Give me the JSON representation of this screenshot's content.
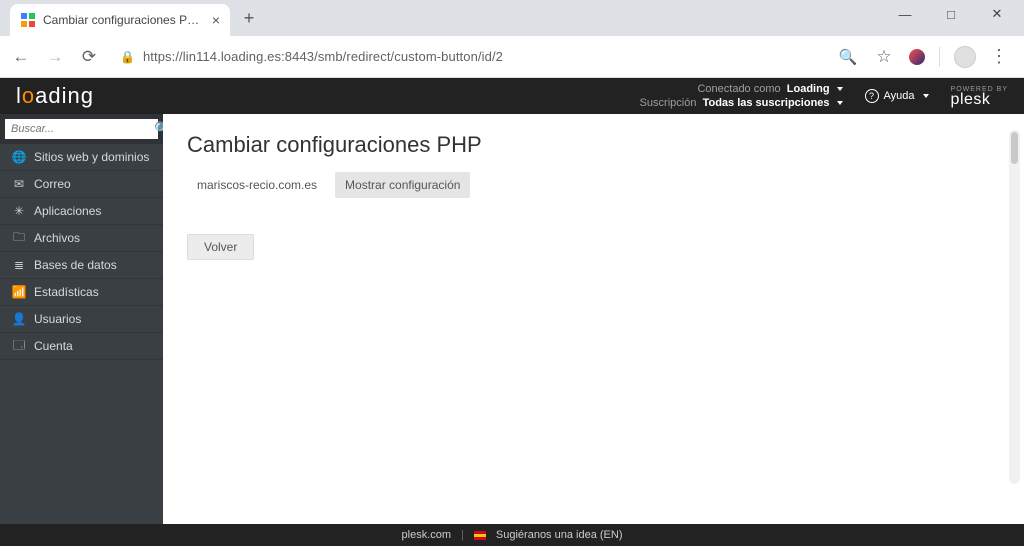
{
  "browser": {
    "tab_title": "Cambiar configuraciones PHP - L",
    "url": "https://lin114.loading.es:8443/smb/redirect/custom-button/id/2"
  },
  "brand": {
    "pre": "l",
    "accent": "o",
    "post": "ading"
  },
  "header": {
    "login_label": "Conectado como",
    "login_value": "Loading",
    "sub_label": "Suscripción",
    "sub_value": "Todas las suscripciones",
    "help": "Ayuda",
    "powered_by": "POWERED BY",
    "plesk": "plesk"
  },
  "sidebar": {
    "search_placeholder": "Buscar...",
    "items": [
      {
        "icon": "globe-icon",
        "label": "Sitios web y dominios"
      },
      {
        "icon": "mail-icon",
        "label": "Correo"
      },
      {
        "icon": "puzzle-icon",
        "label": "Aplicaciones"
      },
      {
        "icon": "folder-icon",
        "label": "Archivos"
      },
      {
        "icon": "database-icon",
        "label": "Bases de datos"
      },
      {
        "icon": "stats-icon",
        "label": "Estadísticas"
      },
      {
        "icon": "user-icon",
        "label": "Usuarios"
      },
      {
        "icon": "card-icon",
        "label": "Cuenta"
      }
    ]
  },
  "main": {
    "title": "Cambiar configuraciones PHP",
    "tabs": [
      {
        "label": "mariscos-recio.com.es",
        "active": false
      },
      {
        "label": "Mostrar configuración",
        "active": true
      }
    ],
    "back": "Volver"
  },
  "footer": {
    "link": "plesk.com",
    "suggest": "Sugiéranos una idea (EN)"
  }
}
